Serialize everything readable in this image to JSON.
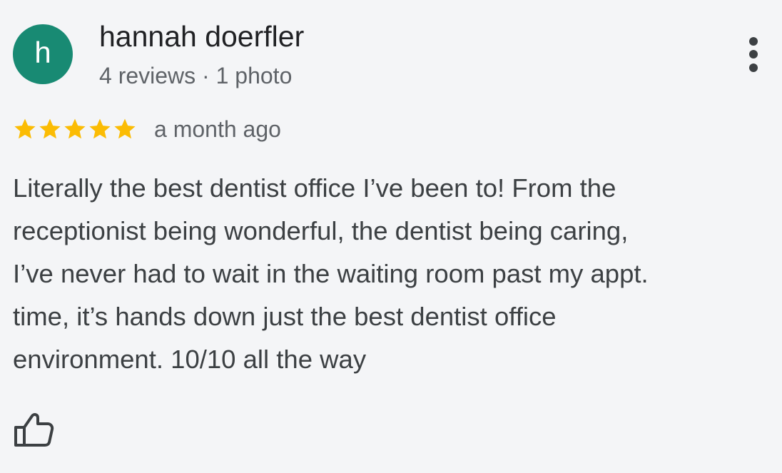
{
  "review": {
    "avatar_letter": "h",
    "author_name": "hannah doerfler",
    "author_meta": "4 reviews · 1 photo",
    "rating": 5,
    "rating_max": 5,
    "date": "a month ago",
    "text_lines": [
      "Literally the best dentist office I’ve been to! From the",
      "receptionist being wonderful, the dentist being caring,",
      "I’ve never had to wait in the waiting room past my appt.",
      "time, it’s hands down just the best dentist office",
      "environment. 10/10 all the way"
    ],
    "icons": {
      "more": "more-vert-icon",
      "star": "star-icon",
      "like": "thumbs-up-icon"
    }
  },
  "colors": {
    "background": "#f4f5f7",
    "avatar": "#188a73",
    "star": "#fbbc04",
    "name_text": "#202124",
    "secondary_text": "#5f6368",
    "body_text": "#3c4043"
  }
}
